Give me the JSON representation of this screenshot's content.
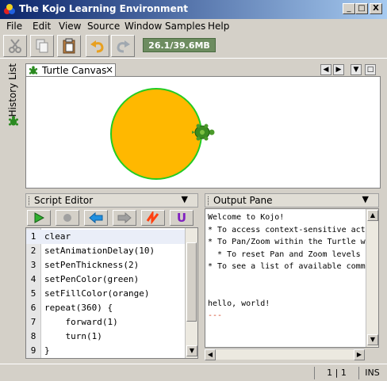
{
  "window": {
    "title": "The Kojo Learning Environment",
    "controls": [
      "_",
      "□",
      "X"
    ]
  },
  "menubar": [
    "File",
    "Edit",
    "View",
    "Source",
    "Window",
    "Samples",
    "Help"
  ],
  "toolbar": {
    "icons": [
      "cut-icon",
      "copy-icon",
      "paste-icon",
      "undo-icon",
      "redo-icon"
    ],
    "memory": "26.1/39.6MB"
  },
  "sidebar": {
    "label": "History List"
  },
  "canvas": {
    "tab_label": "Turtle Canvas",
    "tab_close": "×",
    "circle_fill": "#ffb800",
    "circle_stroke": "#22cc22"
  },
  "script_editor": {
    "title": "Script Editor",
    "lines": [
      {
        "n": "1",
        "code": "clear"
      },
      {
        "n": "2",
        "code": "setAnimationDelay(10)"
      },
      {
        "n": "3",
        "code": "setPenThickness(2)"
      },
      {
        "n": "4",
        "code": "setPenColor(green)"
      },
      {
        "n": "5",
        "code": "setFillColor(orange)"
      },
      {
        "n": "6",
        "code": "repeat(360) {"
      },
      {
        "n": "7",
        "code": "    forward(1)"
      },
      {
        "n": "8",
        "code": "    turn(1)"
      },
      {
        "n": "9",
        "code": "}"
      }
    ]
  },
  "output_pane": {
    "title": "Output Pane",
    "lines": [
      "Welcome to Kojo!",
      "* To access context-sensitive act",
      "* To Pan/Zoom within the Turtle w",
      "  * To reset Pan and Zoom levels",
      "* To see a list of available comm",
      "",
      "",
      "hello, world!",
      "---"
    ]
  },
  "status": {
    "position": "1 | 1",
    "mode": "INS"
  }
}
